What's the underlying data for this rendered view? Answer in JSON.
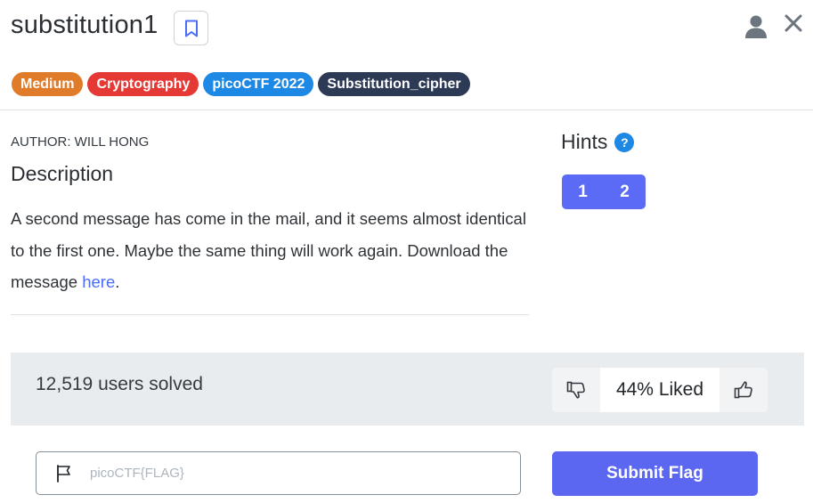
{
  "challenge": {
    "title": "substitution1",
    "bookmark_icon": "bookmark-icon",
    "user_icon": "user-icon",
    "close_icon": "close-icon"
  },
  "tags": [
    {
      "label": "Medium",
      "color": "#e07b2a"
    },
    {
      "label": "Cryptography",
      "color": "#e53935"
    },
    {
      "label": "picoCTF 2022",
      "color": "#1e88e5"
    },
    {
      "label": "Substitution_cipher",
      "color": "#2d3a56"
    }
  ],
  "author": "AUTHOR: WILL HONG",
  "description": {
    "heading": "Description",
    "text_before": "A second message has come in the mail, and it seems almost identical to the first one. Maybe the same thing will work again. Download the message ",
    "link_text": "here",
    "text_after": "."
  },
  "hints": {
    "label": "Hints",
    "help_glyph": "?",
    "buttons": [
      "1",
      "2"
    ]
  },
  "stats": {
    "solved": "12,519 users solved",
    "liked": "44% Liked",
    "thumbs_down_icon": "thumbs-down-icon",
    "thumbs_up_icon": "thumbs-up-icon"
  },
  "flag": {
    "placeholder": "picoCTF{FLAG}",
    "value": "",
    "flag_icon": "flag-icon",
    "submit_label": "Submit Flag"
  }
}
